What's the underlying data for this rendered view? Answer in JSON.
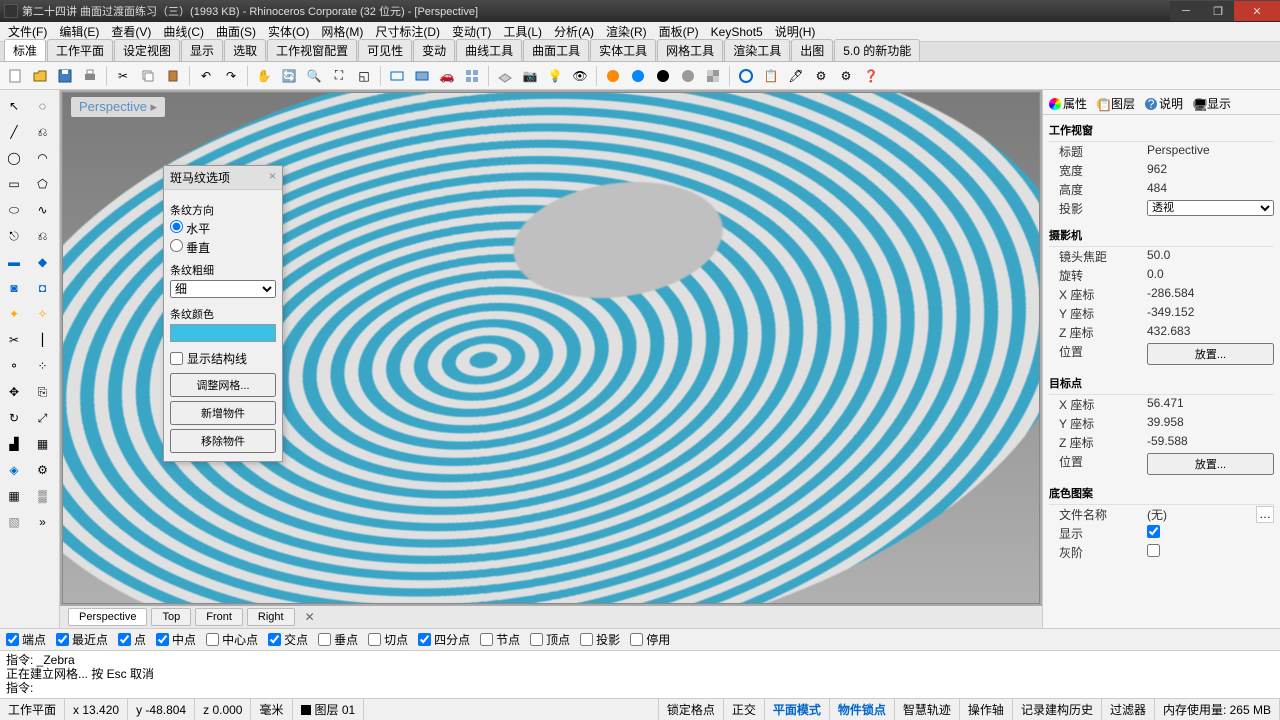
{
  "window": {
    "title": "第二十四讲 曲面过渡面练习（三）(1993 KB) - Rhinoceros Corporate (32 位元) - [Perspective]",
    "min": "─",
    "max": "❐",
    "close": "✕"
  },
  "menu": [
    "文件(F)",
    "编辑(E)",
    "查看(V)",
    "曲线(C)",
    "曲面(S)",
    "实体(O)",
    "网格(M)",
    "尺寸标注(D)",
    "变动(T)",
    "工具(L)",
    "分析(A)",
    "渲染(R)",
    "面板(P)",
    "KeyShot5",
    "说明(H)"
  ],
  "tabs": [
    "标准",
    "工作平面",
    "设定视图",
    "显示",
    "选取",
    "工作视窗配置",
    "可见性",
    "变动",
    "曲线工具",
    "曲面工具",
    "实体工具",
    "网格工具",
    "渲染工具",
    "出图",
    "5.0 的新功能"
  ],
  "viewport": {
    "label": "Perspective"
  },
  "viewport_tabs": [
    "Perspective",
    "Top",
    "Front",
    "Right"
  ],
  "zebra": {
    "title": "斑马纹选项",
    "close": "×",
    "dir_label": "条纹方向",
    "horiz": "水平",
    "vert": "垂直",
    "thick_label": "条纹粗细",
    "thick_value": "细",
    "color_label": "条纹颜色",
    "show_iso": "显示结构线",
    "btn_adjust": "调整网格...",
    "btn_add": "新增物件",
    "btn_remove": "移除物件"
  },
  "panel": {
    "tabs": {
      "props": "属性",
      "layers": "图层",
      "notes": "说明",
      "display": "显示"
    },
    "viewport": {
      "header": "工作视窗",
      "title_l": "标题",
      "title_v": "Perspective",
      "width_l": "宽度",
      "width_v": "962",
      "height_l": "高度",
      "height_v": "484",
      "proj_l": "投影",
      "proj_v": "透视"
    },
    "camera": {
      "header": "摄影机",
      "lens_l": "镜头焦距",
      "lens_v": "50.0",
      "rot_l": "旋转",
      "rot_v": "0.0",
      "x_l": "X 座标",
      "x_v": "-286.584",
      "y_l": "Y 座标",
      "y_v": "-349.152",
      "z_l": "Z 座标",
      "z_v": "432.683",
      "pos_l": "位置",
      "pos_btn": "放置..."
    },
    "target": {
      "header": "目标点",
      "x_l": "X 座标",
      "x_v": "56.471",
      "y_l": "Y 座标",
      "y_v": "39.958",
      "z_l": "Z 座标",
      "z_v": "-59.588",
      "pos_l": "位置",
      "pos_btn": "放置..."
    },
    "wallpaper": {
      "header": "底色图案",
      "file_l": "文件名称",
      "file_v": "(无)",
      "show_l": "显示",
      "gray_l": "灰阶"
    }
  },
  "osnap": [
    "端点",
    "最近点",
    "点",
    "中点",
    "中心点",
    "交点",
    "垂点",
    "切点",
    "四分点",
    "节点",
    "顶点"
  ],
  "osnap_checked": [
    true,
    true,
    true,
    true,
    false,
    true,
    false,
    false,
    true,
    false,
    false
  ],
  "osnap_proj": "投影",
  "osnap_disable": "停用",
  "command": {
    "line1": "指令: _Zebra",
    "line2": "正在建立网格... 按 Esc 取消",
    "prompt": "指令:"
  },
  "status": {
    "cplane": "工作平面",
    "x": "x 13.420",
    "y": "y -48.804",
    "z": "z 0.000",
    "units": "毫米",
    "layer": "图层 01",
    "grid_snap": "锁定格点",
    "ortho": "正交",
    "planar": "平面模式",
    "osnap": "物件锁点",
    "smart": "智慧轨迹",
    "gumball": "操作轴",
    "history": "记录建构历史",
    "filter": "过滤器",
    "mem": "内存使用量: 265 MB"
  }
}
